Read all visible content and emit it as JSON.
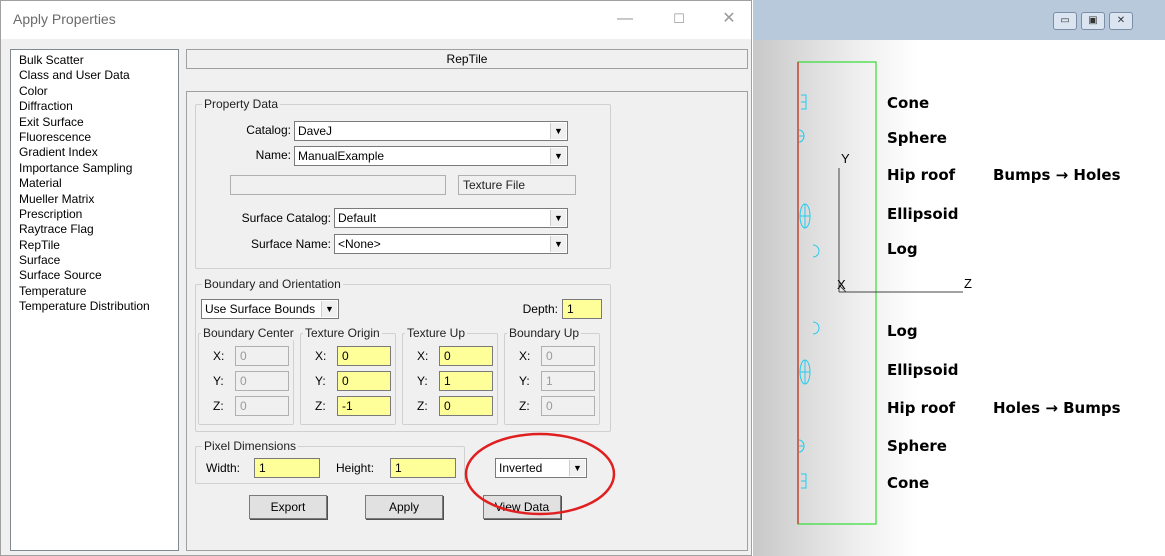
{
  "window": {
    "title": "Apply Properties",
    "minimize": "—",
    "maximize": "☐",
    "close": "✕"
  },
  "property_list": [
    "Bulk Scatter",
    "Class and User Data",
    "Color",
    "Diffraction",
    "Exit Surface",
    "Fluorescence",
    "Gradient Index",
    "Importance Sampling",
    "Material",
    "Mueller Matrix",
    "Prescription",
    "Raytrace Flag",
    "RepTile",
    "Surface",
    "Surface Source",
    "Temperature",
    "Temperature Distribution"
  ],
  "header": "RepTile",
  "property_data": {
    "legend": "Property Data",
    "catalog_label": "Catalog:",
    "catalog_value": "DaveJ",
    "name_label": "Name:",
    "name_value": "ManualExample",
    "texture_file_value": "",
    "texture_file_button": "Texture File",
    "surface_catalog_label": "Surface Catalog:",
    "surface_catalog_value": "Default",
    "surface_name_label": "Surface Name:",
    "surface_name_value": "<None>"
  },
  "boundary": {
    "legend": "Boundary and Orientation",
    "bounds_value": "Use Surface Bounds",
    "depth_label": "Depth:",
    "depth_value": "1",
    "groups": [
      {
        "legend": "Boundary Center",
        "x": "0",
        "y": "0",
        "z": "0",
        "editable": false
      },
      {
        "legend": "Texture Origin",
        "x": "0",
        "y": "0",
        "z": "-1",
        "editable": true
      },
      {
        "legend": "Texture Up",
        "x": "0",
        "y": "1",
        "z": "0",
        "editable": true
      },
      {
        "legend": "Boundary Up",
        "x": "0",
        "y": "1",
        "z": "0",
        "editable": false
      }
    ],
    "x_label": "X:",
    "y_label": "Y:",
    "z_label": "Z:"
  },
  "pixel": {
    "legend": "Pixel Dimensions",
    "width_label": "Width:",
    "width_value": "1",
    "height_label": "Height:",
    "height_value": "1",
    "mode_value": "Inverted"
  },
  "buttons": {
    "export": "Export",
    "apply": "Apply",
    "view_data": "View Data"
  },
  "viewer": {
    "axis_y": "Y",
    "axis_x": "X",
    "axis_z": "Z",
    "upper_labels": [
      "Cone",
      "Sphere",
      "Hip roof",
      "Ellipsoid",
      "Log"
    ],
    "upper_note": "Bumps → Holes",
    "lower_labels": [
      "Log",
      "Ellipsoid",
      "Hip roof",
      "Sphere",
      "Cone"
    ],
    "lower_note": "Holes → Bumps",
    "win_buttons": [
      "▭",
      "▣",
      "✕"
    ]
  },
  "colors": {
    "highlight_circle": "#e02020",
    "frame": "#33dd33",
    "shapes": "#22ccee",
    "axis_line": "#cc2222"
  }
}
